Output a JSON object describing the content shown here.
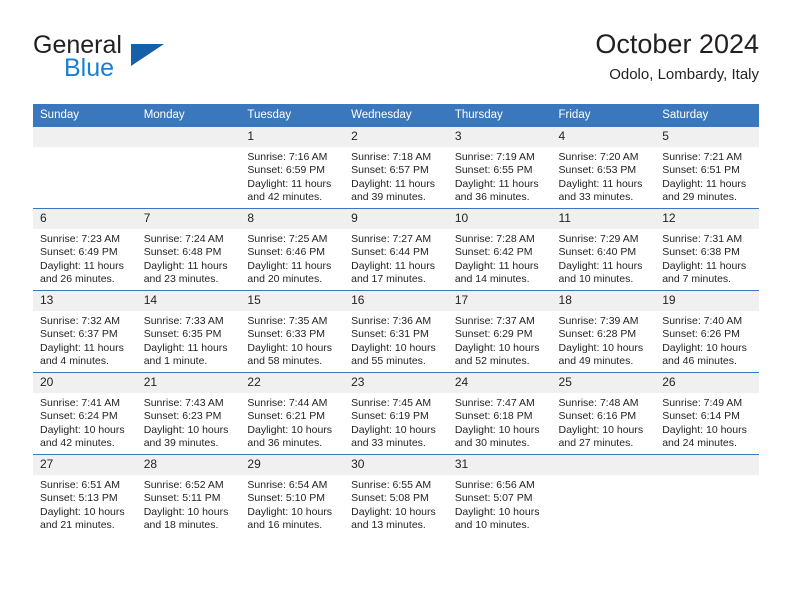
{
  "brand": {
    "name_part1": "General",
    "name_part2": "Blue",
    "triangle_color": "#1560a8",
    "blue_color": "#1a7fd4"
  },
  "header": {
    "title": "October 2024",
    "subtitle": "Odolo, Lombardy, Italy"
  },
  "theme": {
    "header_bg": "#3b77bc",
    "daynum_bg": "#f0f0f0",
    "text_color": "#231f20"
  },
  "weekdays": [
    "Sunday",
    "Monday",
    "Tuesday",
    "Wednesday",
    "Thursday",
    "Friday",
    "Saturday"
  ],
  "weeks": [
    [
      {
        "day": "",
        "sunrise": "",
        "sunset": "",
        "daylight": "",
        "empty": true
      },
      {
        "day": "",
        "sunrise": "",
        "sunset": "",
        "daylight": "",
        "empty": true
      },
      {
        "day": "1",
        "sunrise": "Sunrise: 7:16 AM",
        "sunset": "Sunset: 6:59 PM",
        "daylight": "Daylight: 11 hours and 42 minutes."
      },
      {
        "day": "2",
        "sunrise": "Sunrise: 7:18 AM",
        "sunset": "Sunset: 6:57 PM",
        "daylight": "Daylight: 11 hours and 39 minutes."
      },
      {
        "day": "3",
        "sunrise": "Sunrise: 7:19 AM",
        "sunset": "Sunset: 6:55 PM",
        "daylight": "Daylight: 11 hours and 36 minutes."
      },
      {
        "day": "4",
        "sunrise": "Sunrise: 7:20 AM",
        "sunset": "Sunset: 6:53 PM",
        "daylight": "Daylight: 11 hours and 33 minutes."
      },
      {
        "day": "5",
        "sunrise": "Sunrise: 7:21 AM",
        "sunset": "Sunset: 6:51 PM",
        "daylight": "Daylight: 11 hours and 29 minutes."
      }
    ],
    [
      {
        "day": "6",
        "sunrise": "Sunrise: 7:23 AM",
        "sunset": "Sunset: 6:49 PM",
        "daylight": "Daylight: 11 hours and 26 minutes."
      },
      {
        "day": "7",
        "sunrise": "Sunrise: 7:24 AM",
        "sunset": "Sunset: 6:48 PM",
        "daylight": "Daylight: 11 hours and 23 minutes."
      },
      {
        "day": "8",
        "sunrise": "Sunrise: 7:25 AM",
        "sunset": "Sunset: 6:46 PM",
        "daylight": "Daylight: 11 hours and 20 minutes."
      },
      {
        "day": "9",
        "sunrise": "Sunrise: 7:27 AM",
        "sunset": "Sunset: 6:44 PM",
        "daylight": "Daylight: 11 hours and 17 minutes."
      },
      {
        "day": "10",
        "sunrise": "Sunrise: 7:28 AM",
        "sunset": "Sunset: 6:42 PM",
        "daylight": "Daylight: 11 hours and 14 minutes."
      },
      {
        "day": "11",
        "sunrise": "Sunrise: 7:29 AM",
        "sunset": "Sunset: 6:40 PM",
        "daylight": "Daylight: 11 hours and 10 minutes."
      },
      {
        "day": "12",
        "sunrise": "Sunrise: 7:31 AM",
        "sunset": "Sunset: 6:38 PM",
        "daylight": "Daylight: 11 hours and 7 minutes."
      }
    ],
    [
      {
        "day": "13",
        "sunrise": "Sunrise: 7:32 AM",
        "sunset": "Sunset: 6:37 PM",
        "daylight": "Daylight: 11 hours and 4 minutes."
      },
      {
        "day": "14",
        "sunrise": "Sunrise: 7:33 AM",
        "sunset": "Sunset: 6:35 PM",
        "daylight": "Daylight: 11 hours and 1 minute."
      },
      {
        "day": "15",
        "sunrise": "Sunrise: 7:35 AM",
        "sunset": "Sunset: 6:33 PM",
        "daylight": "Daylight: 10 hours and 58 minutes."
      },
      {
        "day": "16",
        "sunrise": "Sunrise: 7:36 AM",
        "sunset": "Sunset: 6:31 PM",
        "daylight": "Daylight: 10 hours and 55 minutes."
      },
      {
        "day": "17",
        "sunrise": "Sunrise: 7:37 AM",
        "sunset": "Sunset: 6:29 PM",
        "daylight": "Daylight: 10 hours and 52 minutes."
      },
      {
        "day": "18",
        "sunrise": "Sunrise: 7:39 AM",
        "sunset": "Sunset: 6:28 PM",
        "daylight": "Daylight: 10 hours and 49 minutes."
      },
      {
        "day": "19",
        "sunrise": "Sunrise: 7:40 AM",
        "sunset": "Sunset: 6:26 PM",
        "daylight": "Daylight: 10 hours and 46 minutes."
      }
    ],
    [
      {
        "day": "20",
        "sunrise": "Sunrise: 7:41 AM",
        "sunset": "Sunset: 6:24 PM",
        "daylight": "Daylight: 10 hours and 42 minutes."
      },
      {
        "day": "21",
        "sunrise": "Sunrise: 7:43 AM",
        "sunset": "Sunset: 6:23 PM",
        "daylight": "Daylight: 10 hours and 39 minutes."
      },
      {
        "day": "22",
        "sunrise": "Sunrise: 7:44 AM",
        "sunset": "Sunset: 6:21 PM",
        "daylight": "Daylight: 10 hours and 36 minutes."
      },
      {
        "day": "23",
        "sunrise": "Sunrise: 7:45 AM",
        "sunset": "Sunset: 6:19 PM",
        "daylight": "Daylight: 10 hours and 33 minutes."
      },
      {
        "day": "24",
        "sunrise": "Sunrise: 7:47 AM",
        "sunset": "Sunset: 6:18 PM",
        "daylight": "Daylight: 10 hours and 30 minutes."
      },
      {
        "day": "25",
        "sunrise": "Sunrise: 7:48 AM",
        "sunset": "Sunset: 6:16 PM",
        "daylight": "Daylight: 10 hours and 27 minutes."
      },
      {
        "day": "26",
        "sunrise": "Sunrise: 7:49 AM",
        "sunset": "Sunset: 6:14 PM",
        "daylight": "Daylight: 10 hours and 24 minutes."
      }
    ],
    [
      {
        "day": "27",
        "sunrise": "Sunrise: 6:51 AM",
        "sunset": "Sunset: 5:13 PM",
        "daylight": "Daylight: 10 hours and 21 minutes."
      },
      {
        "day": "28",
        "sunrise": "Sunrise: 6:52 AM",
        "sunset": "Sunset: 5:11 PM",
        "daylight": "Daylight: 10 hours and 18 minutes."
      },
      {
        "day": "29",
        "sunrise": "Sunrise: 6:54 AM",
        "sunset": "Sunset: 5:10 PM",
        "daylight": "Daylight: 10 hours and 16 minutes."
      },
      {
        "day": "30",
        "sunrise": "Sunrise: 6:55 AM",
        "sunset": "Sunset: 5:08 PM",
        "daylight": "Daylight: 10 hours and 13 minutes."
      },
      {
        "day": "31",
        "sunrise": "Sunrise: 6:56 AM",
        "sunset": "Sunset: 5:07 PM",
        "daylight": "Daylight: 10 hours and 10 minutes."
      },
      {
        "day": "",
        "sunrise": "",
        "sunset": "",
        "daylight": "",
        "empty": true
      },
      {
        "day": "",
        "sunrise": "",
        "sunset": "",
        "daylight": "",
        "empty": true
      }
    ]
  ]
}
